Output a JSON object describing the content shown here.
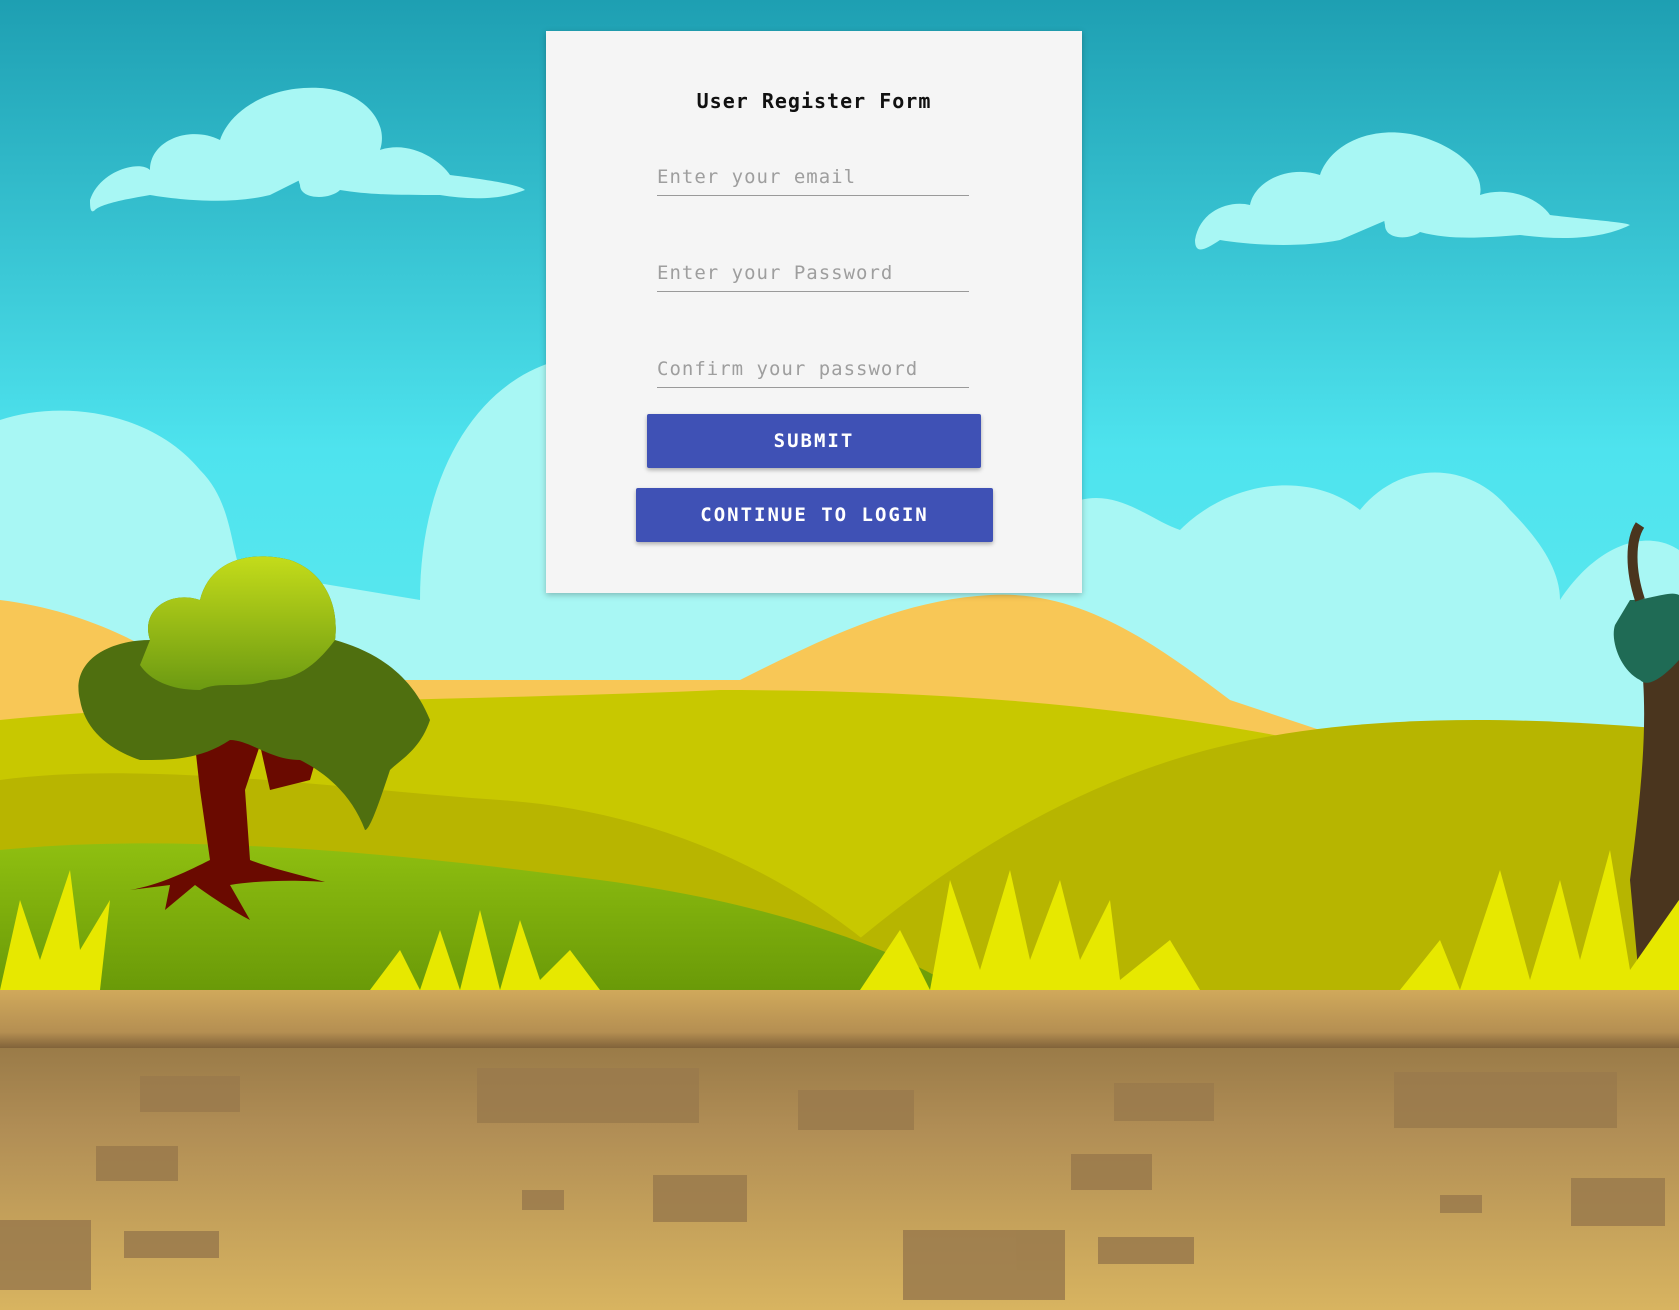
{
  "form": {
    "title": "User Register Form",
    "email_placeholder": "Enter your email",
    "password_placeholder": "Enter your Password",
    "confirm_placeholder": "Confirm your password",
    "submit_label": "SUBMIT",
    "login_label": "CONTINUE TO LOGIN"
  },
  "colors": {
    "button": "#3f51b5",
    "card": "#f5f5f5",
    "sky_top": "#1e9fb2",
    "sky_bottom": "#4ee3ee",
    "ground": "#c9a85d"
  },
  "background": {
    "scene": "cartoon-landscape",
    "elements": [
      "cloud-icon",
      "cloud-icon",
      "hill-icon",
      "tree-icon",
      "grass-tuft-icon",
      "palm-tree-icon",
      "brick-ground"
    ]
  }
}
